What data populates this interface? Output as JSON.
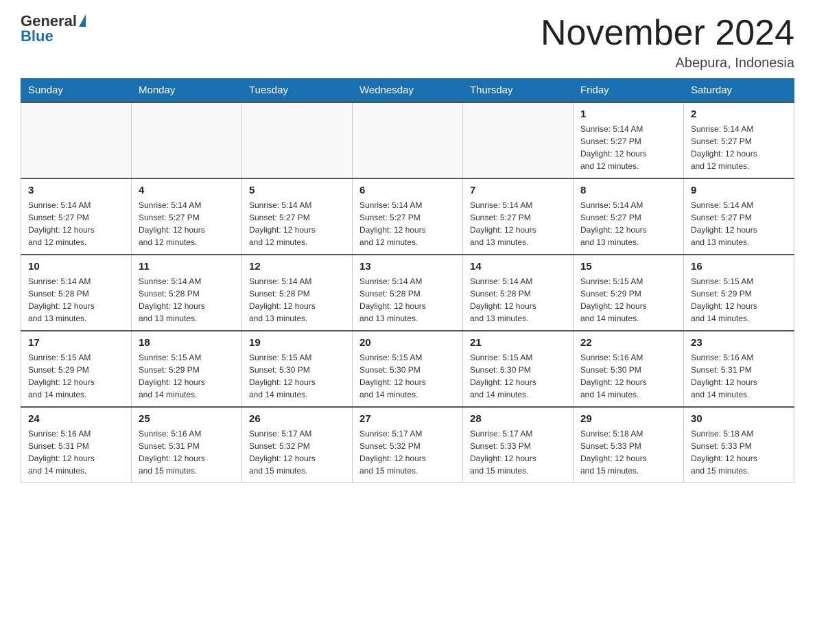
{
  "header": {
    "logo_main": "General",
    "logo_blue": "Blue",
    "title": "November 2024",
    "location": "Abepura, Indonesia"
  },
  "days_of_week": [
    "Sunday",
    "Monday",
    "Tuesday",
    "Wednesday",
    "Thursday",
    "Friday",
    "Saturday"
  ],
  "weeks": [
    {
      "days": [
        {
          "date": "",
          "info": ""
        },
        {
          "date": "",
          "info": ""
        },
        {
          "date": "",
          "info": ""
        },
        {
          "date": "",
          "info": ""
        },
        {
          "date": "",
          "info": ""
        },
        {
          "date": "1",
          "info": "Sunrise: 5:14 AM\nSunset: 5:27 PM\nDaylight: 12 hours\nand 12 minutes."
        },
        {
          "date": "2",
          "info": "Sunrise: 5:14 AM\nSunset: 5:27 PM\nDaylight: 12 hours\nand 12 minutes."
        }
      ]
    },
    {
      "days": [
        {
          "date": "3",
          "info": "Sunrise: 5:14 AM\nSunset: 5:27 PM\nDaylight: 12 hours\nand 12 minutes."
        },
        {
          "date": "4",
          "info": "Sunrise: 5:14 AM\nSunset: 5:27 PM\nDaylight: 12 hours\nand 12 minutes."
        },
        {
          "date": "5",
          "info": "Sunrise: 5:14 AM\nSunset: 5:27 PM\nDaylight: 12 hours\nand 12 minutes."
        },
        {
          "date": "6",
          "info": "Sunrise: 5:14 AM\nSunset: 5:27 PM\nDaylight: 12 hours\nand 12 minutes."
        },
        {
          "date": "7",
          "info": "Sunrise: 5:14 AM\nSunset: 5:27 PM\nDaylight: 12 hours\nand 13 minutes."
        },
        {
          "date": "8",
          "info": "Sunrise: 5:14 AM\nSunset: 5:27 PM\nDaylight: 12 hours\nand 13 minutes."
        },
        {
          "date": "9",
          "info": "Sunrise: 5:14 AM\nSunset: 5:27 PM\nDaylight: 12 hours\nand 13 minutes."
        }
      ]
    },
    {
      "days": [
        {
          "date": "10",
          "info": "Sunrise: 5:14 AM\nSunset: 5:28 PM\nDaylight: 12 hours\nand 13 minutes."
        },
        {
          "date": "11",
          "info": "Sunrise: 5:14 AM\nSunset: 5:28 PM\nDaylight: 12 hours\nand 13 minutes."
        },
        {
          "date": "12",
          "info": "Sunrise: 5:14 AM\nSunset: 5:28 PM\nDaylight: 12 hours\nand 13 minutes."
        },
        {
          "date": "13",
          "info": "Sunrise: 5:14 AM\nSunset: 5:28 PM\nDaylight: 12 hours\nand 13 minutes."
        },
        {
          "date": "14",
          "info": "Sunrise: 5:14 AM\nSunset: 5:28 PM\nDaylight: 12 hours\nand 13 minutes."
        },
        {
          "date": "15",
          "info": "Sunrise: 5:15 AM\nSunset: 5:29 PM\nDaylight: 12 hours\nand 14 minutes."
        },
        {
          "date": "16",
          "info": "Sunrise: 5:15 AM\nSunset: 5:29 PM\nDaylight: 12 hours\nand 14 minutes."
        }
      ]
    },
    {
      "days": [
        {
          "date": "17",
          "info": "Sunrise: 5:15 AM\nSunset: 5:29 PM\nDaylight: 12 hours\nand 14 minutes."
        },
        {
          "date": "18",
          "info": "Sunrise: 5:15 AM\nSunset: 5:29 PM\nDaylight: 12 hours\nand 14 minutes."
        },
        {
          "date": "19",
          "info": "Sunrise: 5:15 AM\nSunset: 5:30 PM\nDaylight: 12 hours\nand 14 minutes."
        },
        {
          "date": "20",
          "info": "Sunrise: 5:15 AM\nSunset: 5:30 PM\nDaylight: 12 hours\nand 14 minutes."
        },
        {
          "date": "21",
          "info": "Sunrise: 5:15 AM\nSunset: 5:30 PM\nDaylight: 12 hours\nand 14 minutes."
        },
        {
          "date": "22",
          "info": "Sunrise: 5:16 AM\nSunset: 5:30 PM\nDaylight: 12 hours\nand 14 minutes."
        },
        {
          "date": "23",
          "info": "Sunrise: 5:16 AM\nSunset: 5:31 PM\nDaylight: 12 hours\nand 14 minutes."
        }
      ]
    },
    {
      "days": [
        {
          "date": "24",
          "info": "Sunrise: 5:16 AM\nSunset: 5:31 PM\nDaylight: 12 hours\nand 14 minutes."
        },
        {
          "date": "25",
          "info": "Sunrise: 5:16 AM\nSunset: 5:31 PM\nDaylight: 12 hours\nand 15 minutes."
        },
        {
          "date": "26",
          "info": "Sunrise: 5:17 AM\nSunset: 5:32 PM\nDaylight: 12 hours\nand 15 minutes."
        },
        {
          "date": "27",
          "info": "Sunrise: 5:17 AM\nSunset: 5:32 PM\nDaylight: 12 hours\nand 15 minutes."
        },
        {
          "date": "28",
          "info": "Sunrise: 5:17 AM\nSunset: 5:33 PM\nDaylight: 12 hours\nand 15 minutes."
        },
        {
          "date": "29",
          "info": "Sunrise: 5:18 AM\nSunset: 5:33 PM\nDaylight: 12 hours\nand 15 minutes."
        },
        {
          "date": "30",
          "info": "Sunrise: 5:18 AM\nSunset: 5:33 PM\nDaylight: 12 hours\nand 15 minutes."
        }
      ]
    }
  ]
}
